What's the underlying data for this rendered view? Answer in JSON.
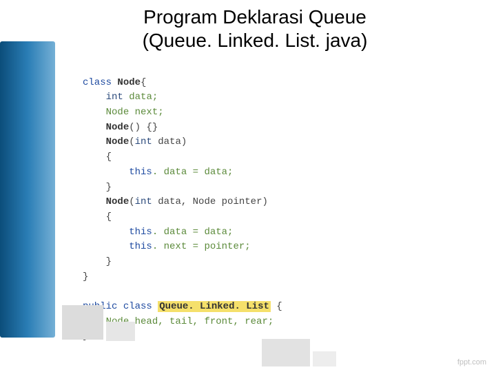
{
  "title_line1": "Program Deklarasi Queue",
  "title_line2": "(Queue. Linked. List. java)",
  "code": {
    "l1a": "class",
    "l1b": "Node",
    "l1c": "{",
    "l2a": "int",
    "l2b": "data;",
    "l3a": "Node",
    "l3b": "next;",
    "l4a": "Node",
    "l4b": "() {}",
    "l5a": "Node",
    "l5b": "(",
    "l5c": "int",
    "l5d": " data)",
    "l6": "{",
    "l7a": "this",
    "l7b": ". data = data;",
    "l8": "}",
    "l9a": "Node",
    "l9b": "(",
    "l9c": "int",
    "l9d": " data, Node pointer)",
    "l10": "{",
    "l11a": "this",
    "l11b": ". data = data;",
    "l12a": "this",
    "l12b": ". next = pointer;",
    "l13": "}",
    "l14": "}",
    "l16a": "public",
    "l16b": "class",
    "l16c": "Queue. Linked. List",
    "l16d": " {",
    "l17a": "Node",
    "l17b": "head, tail, front, rear;",
    "l18": "}"
  },
  "footer": "fppt.com"
}
